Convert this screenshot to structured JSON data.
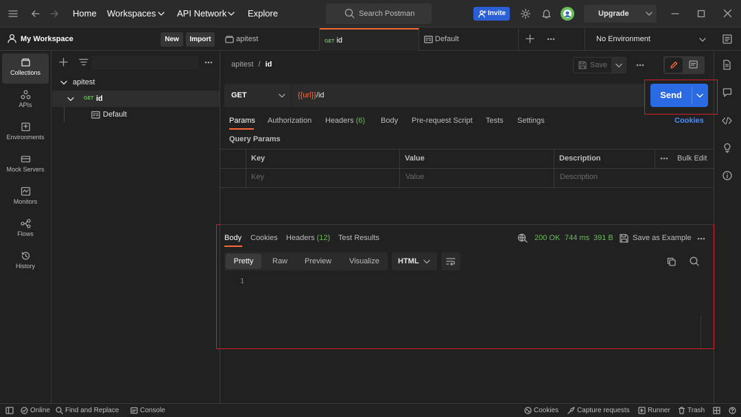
{
  "topbar": {
    "nav": [
      "Home",
      "Workspaces",
      "API Network",
      "Explore"
    ],
    "search_placeholder": "Search Postman",
    "invite_label": "Invite",
    "upgrade_label": "Upgrade"
  },
  "workspace": {
    "name": "My Workspace",
    "new_label": "New",
    "import_label": "Import"
  },
  "tabs": [
    {
      "label": "apitest"
    },
    {
      "method": "GET",
      "label": "id"
    },
    {
      "label": "Default"
    }
  ],
  "environment": "No Environment",
  "rail": [
    {
      "label": "Collections",
      "icon": "collections-icon"
    },
    {
      "label": "APIs",
      "icon": "apis-icon"
    },
    {
      "label": "Environments",
      "icon": "environments-icon"
    },
    {
      "label": "Mock Servers",
      "icon": "mock-servers-icon"
    },
    {
      "label": "Monitors",
      "icon": "monitors-icon"
    },
    {
      "label": "Flows",
      "icon": "flows-icon"
    },
    {
      "label": "History",
      "icon": "history-icon"
    }
  ],
  "tree": {
    "collection": "apitest",
    "request_method": "GET",
    "request": "id",
    "example": "Default"
  },
  "request": {
    "breadcrumb_parent": "apitest",
    "breadcrumb_sep": "/",
    "breadcrumb_current": "id",
    "save_label": "Save",
    "method": "GET",
    "url_var": "{{url}}",
    "url_path": "/id",
    "send_label": "Send",
    "tabs": {
      "params": "Params",
      "authorization": "Authorization",
      "headers": "Headers",
      "headers_count": "(6)",
      "body": "Body",
      "prerequest": "Pre-request Script",
      "tests": "Tests",
      "settings": "Settings"
    },
    "cookies_label": "Cookies",
    "query_params_title": "Query Params",
    "table": {
      "headers": [
        "Key",
        "Value",
        "Description"
      ],
      "bulk_edit": "Bulk Edit",
      "placeholders": [
        "Key",
        "Value",
        "Description"
      ]
    }
  },
  "response": {
    "tabs": {
      "body": "Body",
      "cookies": "Cookies",
      "headers": "Headers",
      "headers_count": "(12)",
      "test_results": "Test Results"
    },
    "status": "200 OK",
    "time": "744 ms",
    "size": "391 B",
    "save_example": "Save as Example",
    "views": [
      "Pretty",
      "Raw",
      "Preview",
      "Visualize"
    ],
    "format": "HTML",
    "line_number": "1"
  },
  "statusbar": {
    "online": "Online",
    "find_replace": "Find and Replace",
    "console": "Console",
    "cookies": "Cookies",
    "capture": "Capture requests",
    "runner": "Runner",
    "trash": "Trash"
  },
  "colors": {
    "accent": "#2a6ae3",
    "highlight": "#d81e2a",
    "get_method": "#6bbd5b",
    "url_var": "#ff6c37",
    "status_ok": "#6bbd5b"
  }
}
